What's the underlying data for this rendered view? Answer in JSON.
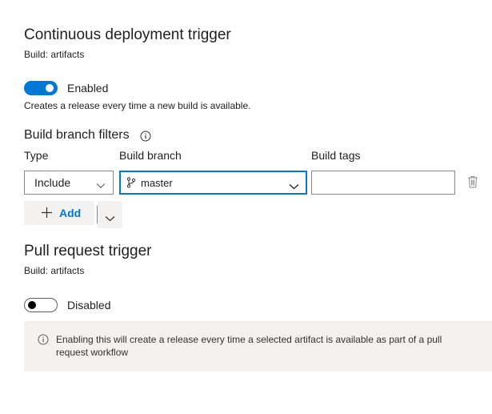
{
  "cd_trigger": {
    "title": "Continuous deployment trigger",
    "subtitle": "Build: artifacts",
    "toggle": {
      "state": "on",
      "label": "Enabled"
    },
    "description": "Creates a release every time a new build is available."
  },
  "branch_filters": {
    "title": "Build branch filters",
    "icon": "info-icon",
    "columns": [
      "Type",
      "Build branch",
      "Build tags"
    ],
    "row": {
      "type_value": "Include",
      "branch_icon": "branch-icon",
      "branch_value": "master",
      "tags_value": "",
      "delete_icon": "trash-icon"
    },
    "add_label": "Add"
  },
  "pr_trigger": {
    "title": "Pull request trigger",
    "subtitle": "Build: artifacts",
    "toggle": {
      "state": "off",
      "label": "Disabled"
    },
    "info_icon": "info-icon",
    "info_text_line1": "Enabling this will create a release every time a selected artifact is available as part of a pull",
    "info_text_line2": "request workflow"
  },
  "colors": {
    "accent": "#0078d4",
    "text": "#201f1e",
    "panel": "#f3f2f1"
  }
}
